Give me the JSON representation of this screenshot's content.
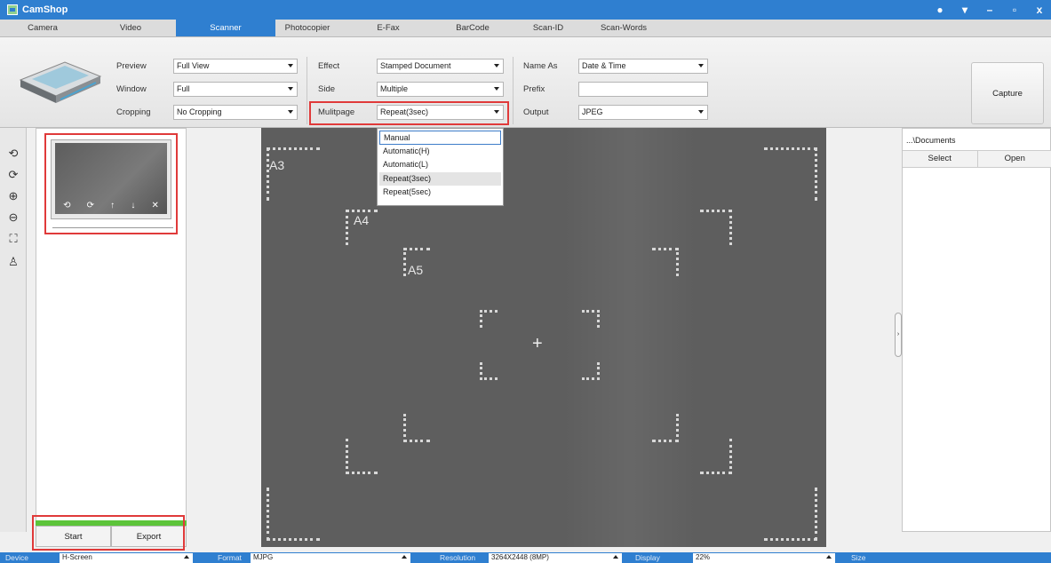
{
  "app": {
    "title": "CamShop",
    "window_buttons": [
      "●",
      "▾",
      "–",
      "▫",
      "x"
    ]
  },
  "tabs": [
    "Camera",
    "Video",
    "Scanner",
    "Photocopier",
    "E-Fax",
    "BarCode",
    "Scan-ID",
    "Scan-Words"
  ],
  "active_tab": "Scanner",
  "toolbar": {
    "preview_label": "Preview",
    "preview_value": "Full View",
    "window_label": "Window",
    "window_value": "Full",
    "cropping_label": "Cropping",
    "cropping_value": "No Cropping",
    "effect_label": "Effect",
    "effect_value": "Stamped Document",
    "side_label": "Side",
    "side_value": "Multiple",
    "multipage_label": "Mulitpage",
    "multipage_value": "Repeat(3sec)",
    "nameas_label": "Name As",
    "nameas_value": "Date & Time",
    "prefix_label": "Prefix",
    "prefix_value": "",
    "output_label": "Output",
    "output_value": "JPEG",
    "capture_label": "Capture"
  },
  "multipage_options": [
    "Manual",
    "Automatic(H)",
    "Automatic(L)",
    "Repeat(3sec)",
    "Repeat(5sec)"
  ],
  "multipage_selected_index": 3,
  "left_tools": [
    "rotate-left-icon",
    "rotate-right-icon",
    "zoom-in-icon",
    "zoom-out-icon",
    "fit-icon",
    "stamp-icon"
  ],
  "thumbnail_tools": [
    "⟲",
    "⟳",
    "↑",
    "↓",
    "✕"
  ],
  "preview_labels": {
    "a3": "A3",
    "a4": "A4",
    "a5": "A5"
  },
  "bottom_buttons": {
    "start": "Start",
    "export": "Export"
  },
  "right_pane": {
    "path": "...\\Documents",
    "select": "Select",
    "open": "Open"
  },
  "statusbar": {
    "device_label": "Device",
    "device_value": "H-Screen",
    "format_label": "Format",
    "format_value": "MJPG",
    "resolution_label": "Resolution",
    "resolution_value": "3264X2448 (8MP)",
    "display_label": "Display",
    "display_value": "22%",
    "size_label": "Size"
  },
  "colors": {
    "accent": "#2f7fd0",
    "highlight": "#e03a3a",
    "progress": "#5cc43a"
  }
}
